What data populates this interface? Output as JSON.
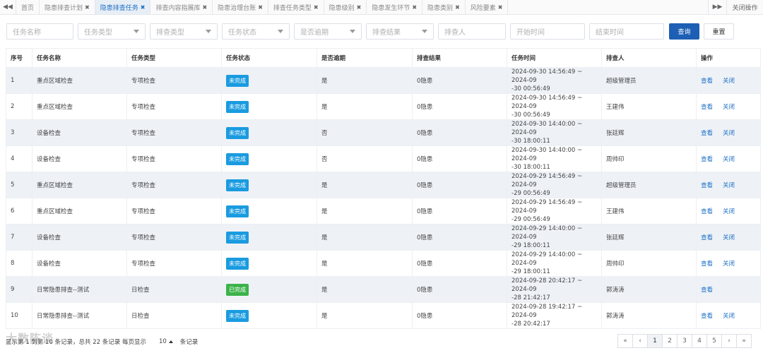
{
  "tabbar": {
    "prev_icon": "◀◀",
    "next_icon": "▶▶",
    "close_ops": "关闭操作",
    "tabs": [
      {
        "label": "首页",
        "closable": false,
        "active": false
      },
      {
        "label": "隐患排查计划",
        "closable": true,
        "active": false
      },
      {
        "label": "隐患排查任务",
        "closable": true,
        "active": true
      },
      {
        "label": "排查内容指展库",
        "closable": true,
        "active": false
      },
      {
        "label": "隐患治理台账",
        "closable": true,
        "active": false
      },
      {
        "label": "排查任务类型",
        "closable": true,
        "active": false
      },
      {
        "label": "隐患级别",
        "closable": true,
        "active": false
      },
      {
        "label": "隐患发生环节",
        "closable": true,
        "active": false
      },
      {
        "label": "隐患类别",
        "closable": true,
        "active": false
      },
      {
        "label": "风险要素",
        "closable": true,
        "active": false
      }
    ]
  },
  "filters": {
    "task_name": "任务名称",
    "task_type": "任务类型",
    "check_type": "排查类型",
    "task_status": "任务状态",
    "overdue": "是否逾期",
    "check_result": "排查结果",
    "checker": "排查人",
    "start_time": "开始时间",
    "end_time": "结束时间",
    "query_label": "查询",
    "reset_label": "重置"
  },
  "table": {
    "headers": [
      "序号",
      "任务名称",
      "任务类型",
      "任务状态",
      "是否逾期",
      "排查结果",
      "任务时间",
      "排查人",
      "操作"
    ],
    "rows": [
      {
        "no": "1",
        "name": "重点区域检查",
        "type": "专项检查",
        "status": "未完成",
        "overdue": "是",
        "result": "0隐患",
        "time1": "2024-09-30 14:56:49 ~ 2024-09",
        "time2": "-30 00:56:49",
        "checker": "超级管理员",
        "ops": [
          "查看",
          "关闭"
        ]
      },
      {
        "no": "2",
        "name": "重点区域检查",
        "type": "专项检查",
        "status": "未完成",
        "overdue": "是",
        "result": "0隐患",
        "time1": "2024-09-30 14:56:49 ~ 2024-09",
        "time2": "-30 00:56:49",
        "checker": "王建伟",
        "ops": [
          "查看",
          "关闭"
        ]
      },
      {
        "no": "3",
        "name": "设备检查",
        "type": "专项检查",
        "status": "未完成",
        "overdue": "否",
        "result": "0隐患",
        "time1": "2024-09-30 14:40:00 ~ 2024-09",
        "time2": "-30 18:00:11",
        "checker": "张廷辉",
        "ops": [
          "查看",
          "关闭"
        ]
      },
      {
        "no": "4",
        "name": "设备检查",
        "type": "专项检查",
        "status": "未完成",
        "overdue": "否",
        "result": "0隐患",
        "time1": "2024-09-30 14:40:00 ~ 2024-09",
        "time2": "-30 18:00:11",
        "checker": "周帅印",
        "ops": [
          "查看",
          "关闭"
        ]
      },
      {
        "no": "5",
        "name": "重点区域检查",
        "type": "专项检查",
        "status": "未完成",
        "overdue": "是",
        "result": "0隐患",
        "time1": "2024-09-29 14:56:49 ~ 2024-09",
        "time2": "-29 00:56:49",
        "checker": "超级管理员",
        "ops": [
          "查看",
          "关闭"
        ]
      },
      {
        "no": "6",
        "name": "重点区域检查",
        "type": "专项检查",
        "status": "未完成",
        "overdue": "是",
        "result": "0隐患",
        "time1": "2024-09-29 14:56:49 ~ 2024-09",
        "time2": "-29 00:56:49",
        "checker": "王建伟",
        "ops": [
          "查看",
          "关闭"
        ]
      },
      {
        "no": "7",
        "name": "设备检查",
        "type": "专项检查",
        "status": "未完成",
        "overdue": "是",
        "result": "0隐患",
        "time1": "2024-09-29 14:40:00 ~ 2024-09",
        "time2": "-29 18:00:11",
        "checker": "张廷辉",
        "ops": [
          "查看",
          "关闭"
        ]
      },
      {
        "no": "8",
        "name": "设备检查",
        "type": "专项检查",
        "status": "未完成",
        "overdue": "是",
        "result": "0隐患",
        "time1": "2024-09-29 14:40:00 ~ 2024-09",
        "time2": "-29 18:00:11",
        "checker": "周帅印",
        "ops": [
          "查看",
          "关闭"
        ]
      },
      {
        "no": "9",
        "name": "日常隐患排查--测试",
        "type": "日检查",
        "status": "已完成",
        "overdue": "是",
        "result": "0隐患",
        "time1": "2024-09-28 20:42:17 ~ 2024-09",
        "time2": "-28 21:42:17",
        "checker": "郭涛涛",
        "ops": [
          "查看"
        ]
      },
      {
        "no": "10",
        "name": "日常隐患排查--测试",
        "type": "日检查",
        "status": "未完成",
        "overdue": "是",
        "result": "0隐患",
        "time1": "2024-09-28 19:42:17 ~ 2024-09",
        "time2": "-28 20:42:17",
        "checker": "郭涛涛",
        "ops": [
          "查看",
          "关闭"
        ]
      }
    ]
  },
  "footer": {
    "summary": "显示第 1 到第 10 条记录，总共 22 条记录 每页显示",
    "page_size": "10",
    "suffix": "条记录",
    "watermark": "大数陈谈"
  },
  "pager": [
    "«",
    "‹",
    "1",
    "2",
    "3",
    "4",
    "5",
    "›",
    "»"
  ],
  "pager_active": "1",
  "colors": {
    "primary": "#1d5fb4",
    "badge_incomplete": "#1a9be0",
    "badge_complete": "#3cb34a",
    "overdue_red": "#e02020",
    "link": "#1c6fc5"
  }
}
